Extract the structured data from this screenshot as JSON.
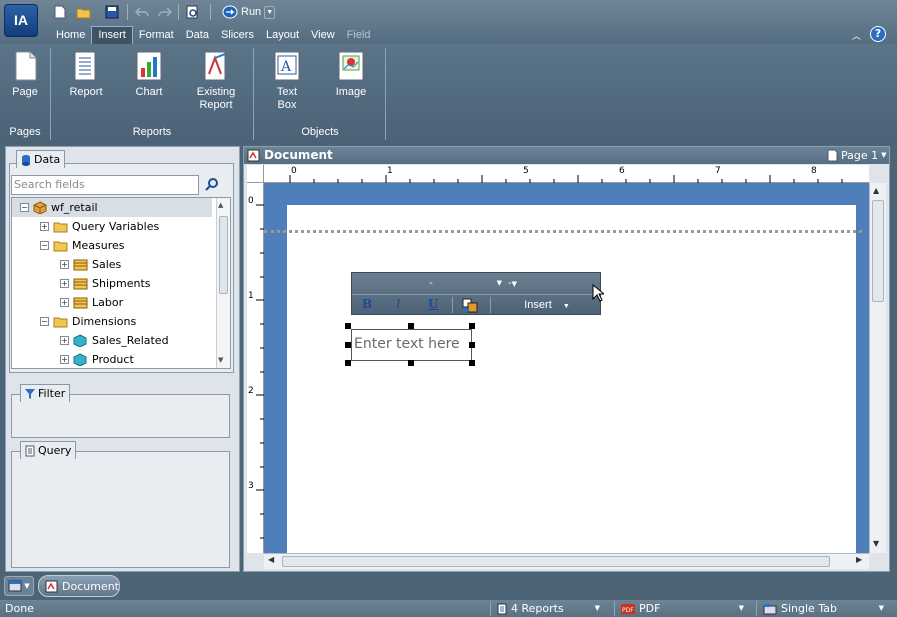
{
  "app": {
    "logo_text": "IA",
    "run_label": "Run"
  },
  "menu": {
    "items": [
      {
        "label": "Home",
        "active": false
      },
      {
        "label": "Insert",
        "active": true
      },
      {
        "label": "Format",
        "active": false
      },
      {
        "label": "Data",
        "active": false
      },
      {
        "label": "Slicers",
        "active": false
      },
      {
        "label": "Layout",
        "active": false
      },
      {
        "label": "View",
        "active": false
      },
      {
        "label": "Field",
        "active": false,
        "disabled": true
      }
    ]
  },
  "ribbon": {
    "buttons": {
      "page": "Page",
      "report": "Report",
      "chart": "Chart",
      "existing_report_l1": "Existing",
      "existing_report_l2": "Report",
      "text_box_l1": "Text",
      "text_box_l2": "Box",
      "image": "Image"
    },
    "groups": {
      "pages": "Pages",
      "reports": "Reports",
      "objects": "Objects"
    }
  },
  "left": {
    "data_tab": "Data",
    "search_placeholder": "Search fields",
    "tree": [
      {
        "label": "wf_retail",
        "exp": "⊟",
        "icon": "cube",
        "indent": 0
      },
      {
        "label": "Query Variables",
        "exp": "⊞",
        "icon": "folder",
        "indent": 1
      },
      {
        "label": "Measures",
        "exp": "⊟",
        "icon": "folder",
        "indent": 1
      },
      {
        "label": "Sales",
        "exp": "⊞",
        "icon": "measure",
        "indent": 2
      },
      {
        "label": "Shipments",
        "exp": "⊞",
        "icon": "measure",
        "indent": 2
      },
      {
        "label": "Labor",
        "exp": "⊞",
        "icon": "measure",
        "indent": 2
      },
      {
        "label": "Dimensions",
        "exp": "⊟",
        "icon": "folder",
        "indent": 1
      },
      {
        "label": "Sales_Related",
        "exp": "⊞",
        "icon": "dimension",
        "indent": 2
      },
      {
        "label": "Product",
        "exp": "⊞",
        "icon": "dimension",
        "indent": 2
      }
    ],
    "filter_tab": "Filter",
    "query_tab": "Query"
  },
  "document": {
    "title": "Document",
    "page_selector": "Page 1",
    "ruler_h": [
      "0",
      "1",
      "5",
      "6",
      "7",
      "8"
    ],
    "ruler_v": [
      "0",
      "1",
      "2",
      "3"
    ],
    "textbox_placeholder": "Enter text here",
    "toolbar": {
      "font_value": "-",
      "size_value": "-",
      "bold": "B",
      "italic": "I",
      "underline": "U",
      "insert_label": "Insert"
    }
  },
  "bottom": {
    "tab_label": "Document"
  },
  "status": {
    "text": "Done",
    "reports": "4 Reports",
    "format": "PDF",
    "tab_mode": "Single Tab"
  },
  "colors": {
    "canvas": "#4f7fba",
    "chrome": "#4d6477",
    "accent": "#1a4d8f"
  }
}
